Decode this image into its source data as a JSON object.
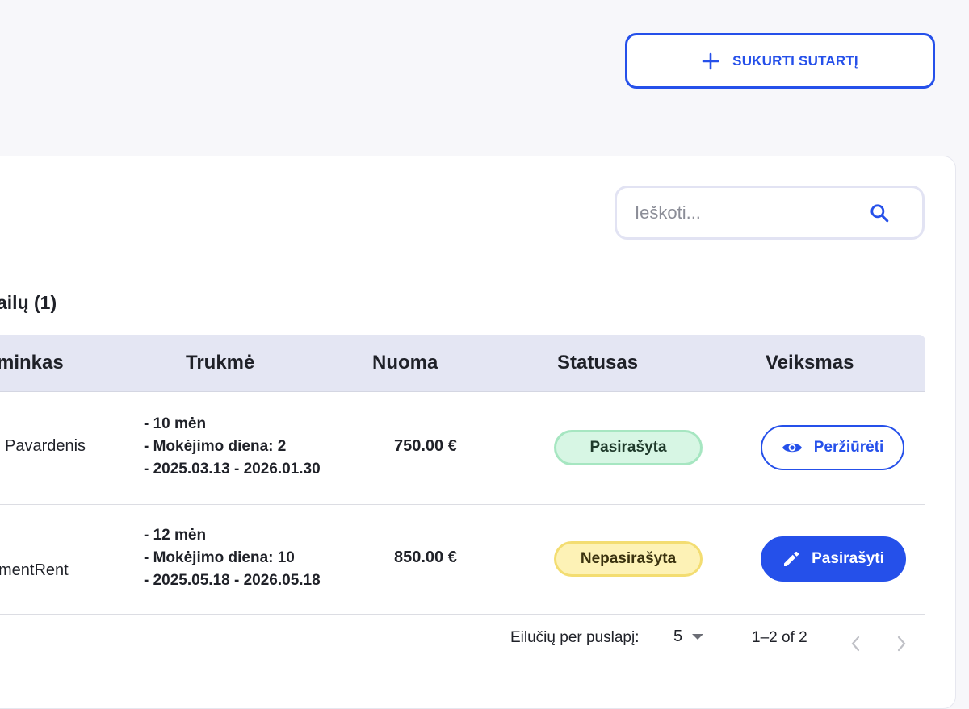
{
  "header": {
    "create_label": "SUKURTI SUTARTĮ"
  },
  "search": {
    "placeholder": "Ieškoti..."
  },
  "section": {
    "title": "ailų (1)"
  },
  "table": {
    "columns": [
      "minkas",
      "Trukmė",
      "Nuoma",
      "Statusas",
      "Veiksmas"
    ],
    "rows": [
      {
        "tenant": "Pavardenis",
        "duration": [
          "- 10 mėn",
          "- Mokėjimo diena: 2",
          "- 2025.03.13 - 2026.01.30"
        ],
        "rent": "750.00 €",
        "status": "Pasirašyta",
        "action": "Peržiūrėti"
      },
      {
        "tenant": "mentRent",
        "duration": [
          "- 12 mėn",
          "- Mokėjimo diena: 10",
          "- 2025.05.18 - 2026.05.18"
        ],
        "rent": "850.00 €",
        "status": "Nepasirašyta",
        "action": "Pasirašyti"
      }
    ]
  },
  "pagination": {
    "rows_label": "Eilučių per puslapį:",
    "rows_value": "5",
    "range": "1–2 of 2"
  },
  "colors": {
    "accent": "#2550ea",
    "signed_bg": "#d7f6e4",
    "unsigned_bg": "#fdf2b6",
    "header_bg": "#e4e6f3"
  }
}
